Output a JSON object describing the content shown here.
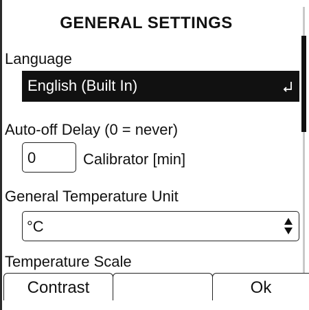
{
  "screen": {
    "title": "GENERAL SETTINGS"
  },
  "language": {
    "label": "Language",
    "value": "English (Built In)",
    "icon": "enter-icon"
  },
  "auto_off": {
    "label": "Auto-off Delay (0 = never)",
    "value": "0",
    "suffix": "Calibrator [min]"
  },
  "temperature_unit": {
    "label": "General Temperature Unit",
    "value": "°C",
    "icon": "up-down-spin-icon"
  },
  "temperature_scale": {
    "label": "Temperature Scale"
  },
  "softkeys": {
    "left": "Contrast",
    "middle": "",
    "right": "Ok"
  },
  "colors": {
    "background": "#ffffff",
    "foreground": "#111111",
    "highlight_background": "#111111",
    "highlight_text": "#ffffff"
  }
}
